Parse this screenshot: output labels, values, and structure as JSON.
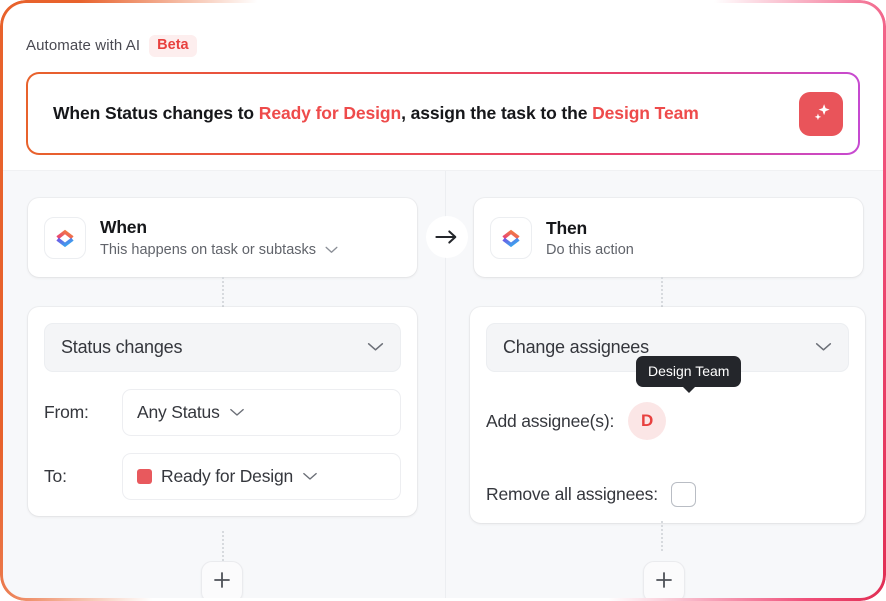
{
  "header": {
    "title": "Automate with AI",
    "badge": "Beta"
  },
  "prompt": {
    "segments": [
      {
        "text": "When Status changes to ",
        "highlight": false
      },
      {
        "text": "Ready for Design",
        "highlight": true
      },
      {
        "text": ", assign the task to the ",
        "highlight": false
      },
      {
        "text": "Design Team",
        "highlight": true
      }
    ],
    "generate_icon": "sparkle-icon",
    "generate_label": "Generate automation with AI"
  },
  "flow": {
    "arrow_icon": "arrow-right-icon",
    "add_step_icon": "plus-icon"
  },
  "when": {
    "logo_icon": "clickup-logo-icon",
    "title": "When",
    "subtitle": "This happens on task or subtasks",
    "subtitle_chevron": "chevron-down-icon",
    "trigger": {
      "label": "Status changes",
      "chevron": "chevron-down-icon"
    },
    "from": {
      "label": "From:",
      "value": "Any Status",
      "chevron": "chevron-down-icon"
    },
    "to": {
      "label": "To:",
      "value": "Ready for Design",
      "status_color": "#e8595d",
      "chevron": "chevron-down-icon"
    }
  },
  "then": {
    "logo_icon": "clickup-logo-icon",
    "title": "Then",
    "subtitle": "Do this action",
    "action": {
      "label": "Change assignees",
      "chevron": "chevron-down-icon"
    },
    "add_assignees": {
      "label": "Add assignee(s):",
      "avatar_initial": "D",
      "tooltip": "Design Team"
    },
    "remove_all": {
      "label": "Remove all assignees:",
      "checked": false
    }
  },
  "colors": {
    "accent_red": "#e8413f",
    "beta_bg": "#fdeeee",
    "sparkle_button": "#e9545a",
    "status_ready_for_design": "#e8595d",
    "canvas_bg": "#f7f8fa",
    "tooltip_bg": "#24262b"
  }
}
